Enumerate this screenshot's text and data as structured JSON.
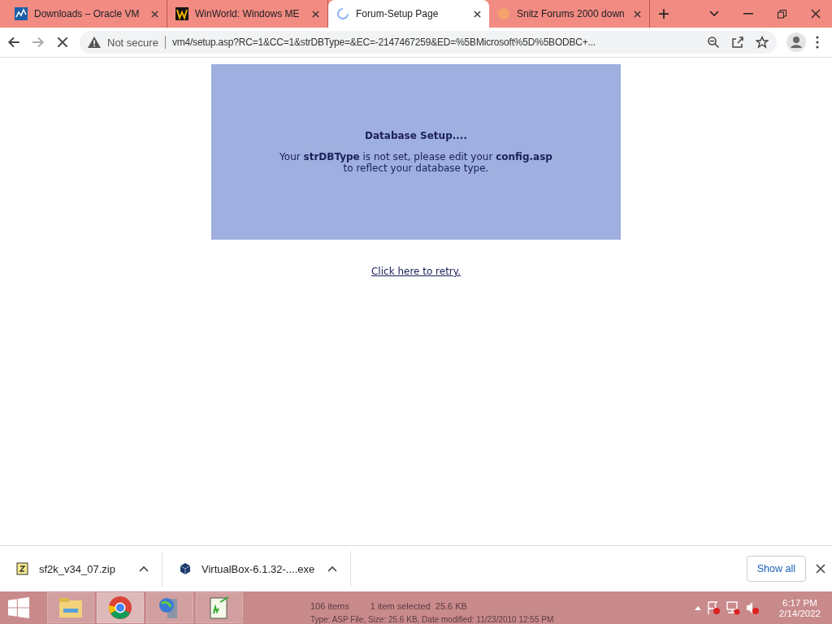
{
  "tabs": [
    {
      "title": "Downloads – Oracle VM",
      "selected": false
    },
    {
      "title": "WinWorld: Windows ME",
      "selected": false
    },
    {
      "title": "Forum-Setup Page",
      "selected": true
    },
    {
      "title": "Snitz Forums 2000 down",
      "selected": false
    }
  ],
  "new_tab": "+",
  "address_bar": {
    "security": "Not secure",
    "url": "vm4/setup.asp?RC=1&CC=1&strDBType=&EC=-2147467259&ED=%5BMicrosoft%5D%5BODBC+..."
  },
  "page": {
    "heading": "Database Setup....",
    "message": "Your **strDBType** is not set, please edit your **config.asp**",
    "message_2": "to reflect your database type.",
    "retry_link": "Click here to retry."
  },
  "downloads": [
    {
      "file": "sf2k_v34_07.zip"
    },
    {
      "file": "VirtualBox-6.1.32-....exe"
    }
  ],
  "show_all": "Show all",
  "taskbar": {
    "apps": [
      {
        "selected": false
      },
      {
        "selected": true
      },
      {
        "selected": false
      },
      {
        "selected": false
      }
    ],
    "behind": {
      "items": "106 items",
      "selected": "1 item selected  25.6 KB",
      "details": "Type: ASP File, Size: 25.6 KB, Date modified: 11/23/2010 12:55 PM"
    },
    "time": "6:17 PM",
    "date": "2/14/2022"
  }
}
